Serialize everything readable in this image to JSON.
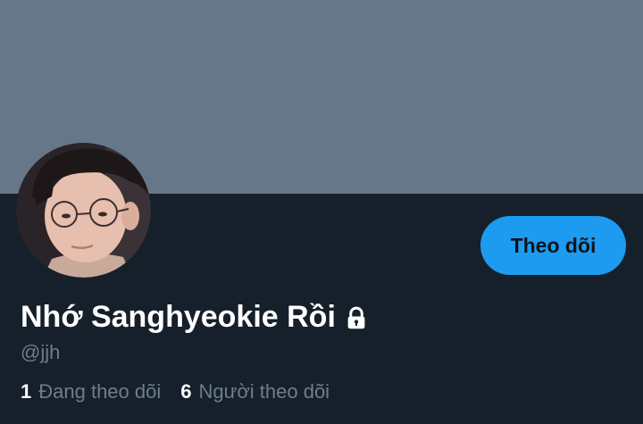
{
  "profile": {
    "display_name": "Nhớ Sanghyeokie Rồi",
    "handle": "@jjh",
    "protected": true,
    "avatar_description": "profile photo"
  },
  "actions": {
    "follow_label": "Theo dõi"
  },
  "stats": {
    "following_count": "1",
    "following_label": "Đang theo dõi",
    "followers_count": "6",
    "followers_label": "Người theo dõi"
  },
  "colors": {
    "banner": "#66778a",
    "background": "#15202b",
    "accent": "#1d9bf0",
    "secondary_text": "#6e7d8c"
  },
  "icons": {
    "lock": "lock-icon"
  }
}
